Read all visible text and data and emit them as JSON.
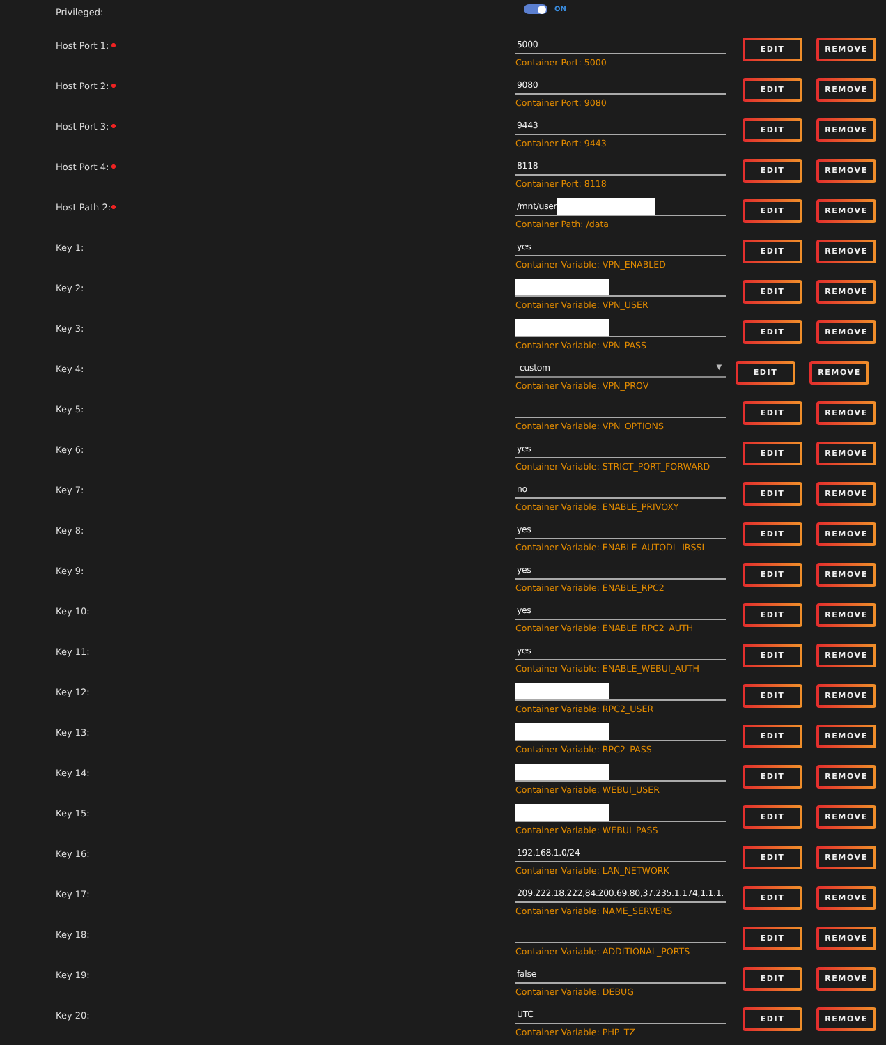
{
  "privileged": {
    "label": "Privileged:",
    "on": true,
    "state_text": "ON"
  },
  "rows": [
    {
      "label": "Host Port 1:",
      "required": true,
      "kind": "text",
      "value": "5000",
      "redacted": false,
      "hint": "Container Port: 5000",
      "edit": "EDIT",
      "remove": "REMOVE"
    },
    {
      "label": "Host Port 2:",
      "required": true,
      "kind": "text",
      "value": "9080",
      "redacted": false,
      "hint": "Container Port: 9080",
      "edit": "EDIT",
      "remove": "REMOVE"
    },
    {
      "label": "Host Port 3:",
      "required": true,
      "kind": "text",
      "value": "9443",
      "redacted": false,
      "hint": "Container Port: 9443",
      "edit": "EDIT",
      "remove": "REMOVE"
    },
    {
      "label": "Host Port 4:",
      "required": true,
      "kind": "text",
      "value": "8118",
      "redacted": false,
      "hint": "Container Port: 8118",
      "edit": "EDIT",
      "remove": "REMOVE"
    },
    {
      "label": "Host Path 2:",
      "required": true,
      "kind": "text",
      "value": "/mnt/user",
      "redacted": true,
      "hint": "Container Path: /data",
      "edit": "EDIT",
      "remove": "REMOVE"
    },
    {
      "label": "Key 1:",
      "required": false,
      "kind": "text",
      "value": "yes",
      "redacted": false,
      "hint": "Container Variable: VPN_ENABLED",
      "edit": "EDIT",
      "remove": "REMOVE"
    },
    {
      "label": "Key 2:",
      "required": false,
      "kind": "text",
      "redacted": true,
      "hint": "Container Variable: VPN_USER",
      "edit": "EDIT",
      "remove": "REMOVE"
    },
    {
      "label": "Key 3:",
      "required": false,
      "kind": "text",
      "redacted": true,
      "hint": "Container Variable: VPN_PASS",
      "edit": "EDIT",
      "remove": "REMOVE"
    },
    {
      "label": "Key 4:",
      "required": false,
      "kind": "select",
      "caret": "▼",
      "value": "custom",
      "redacted": false,
      "hint": "Container Variable: VPN_PROV",
      "edit": "EDIT",
      "remove": "REMOVE"
    },
    {
      "label": "Key 5:",
      "required": false,
      "kind": "text",
      "redacted": false,
      "hint": "Container Variable: VPN_OPTIONS",
      "edit": "EDIT",
      "remove": "REMOVE"
    },
    {
      "label": "Key 6:",
      "required": false,
      "kind": "text",
      "value": "yes",
      "redacted": false,
      "hint": "Container Variable: STRICT_PORT_FORWARD",
      "edit": "EDIT",
      "remove": "REMOVE"
    },
    {
      "label": "Key 7:",
      "required": false,
      "kind": "text",
      "value": "no",
      "redacted": false,
      "hint": "Container Variable: ENABLE_PRIVOXY",
      "edit": "EDIT",
      "remove": "REMOVE"
    },
    {
      "label": "Key 8:",
      "required": false,
      "kind": "text",
      "value": "yes",
      "redacted": false,
      "hint": "Container Variable: ENABLE_AUTODL_IRSSI",
      "edit": "EDIT",
      "remove": "REMOVE"
    },
    {
      "label": "Key 9:",
      "required": false,
      "kind": "text",
      "value": "yes",
      "redacted": false,
      "hint": "Container Variable: ENABLE_RPC2",
      "edit": "EDIT",
      "remove": "REMOVE"
    },
    {
      "label": "Key 10:",
      "required": false,
      "kind": "text",
      "value": "yes",
      "redacted": false,
      "hint": "Container Variable: ENABLE_RPC2_AUTH",
      "edit": "EDIT",
      "remove": "REMOVE"
    },
    {
      "label": "Key 11:",
      "required": false,
      "kind": "text",
      "value": "yes",
      "redacted": false,
      "hint": "Container Variable: ENABLE_WEBUI_AUTH",
      "edit": "EDIT",
      "remove": "REMOVE"
    },
    {
      "label": "Key 12:",
      "required": false,
      "kind": "text",
      "redacted": true,
      "hint": "Container Variable: RPC2_USER",
      "edit": "EDIT",
      "remove": "REMOVE"
    },
    {
      "label": "Key 13:",
      "required": false,
      "kind": "text",
      "redacted": true,
      "hint": "Container Variable: RPC2_PASS",
      "edit": "EDIT",
      "remove": "REMOVE"
    },
    {
      "label": "Key 14:",
      "required": false,
      "kind": "text",
      "redacted": true,
      "hint": "Container Variable: WEBUI_USER",
      "edit": "EDIT",
      "remove": "REMOVE"
    },
    {
      "label": "Key 15:",
      "required": false,
      "kind": "text",
      "redacted": true,
      "hint": "Container Variable: WEBUI_PASS",
      "edit": "EDIT",
      "remove": "REMOVE"
    },
    {
      "label": "Key 16:",
      "required": false,
      "kind": "text",
      "value": "192.168.1.0/24",
      "redacted": false,
      "hint": "Container Variable: LAN_NETWORK",
      "edit": "EDIT",
      "remove": "REMOVE"
    },
    {
      "label": "Key 17:",
      "required": false,
      "kind": "text",
      "value": "209.222.18.222,84.200.69.80,37.235.1.174,1.1.1.",
      "redacted": false,
      "hint": "Container Variable: NAME_SERVERS",
      "edit": "EDIT",
      "remove": "REMOVE"
    },
    {
      "label": "Key 18:",
      "required": false,
      "kind": "text",
      "redacted": false,
      "hint": "Container Variable: ADDITIONAL_PORTS",
      "edit": "EDIT",
      "remove": "REMOVE"
    },
    {
      "label": "Key 19:",
      "required": false,
      "kind": "text",
      "value": "false",
      "redacted": false,
      "hint": "Container Variable: DEBUG",
      "edit": "EDIT",
      "remove": "REMOVE"
    },
    {
      "label": "Key 20:",
      "required": false,
      "kind": "text",
      "value": "UTC",
      "redacted": false,
      "hint": "Container Variable: PHP_TZ",
      "edit": "EDIT",
      "remove": "REMOVE"
    }
  ]
}
